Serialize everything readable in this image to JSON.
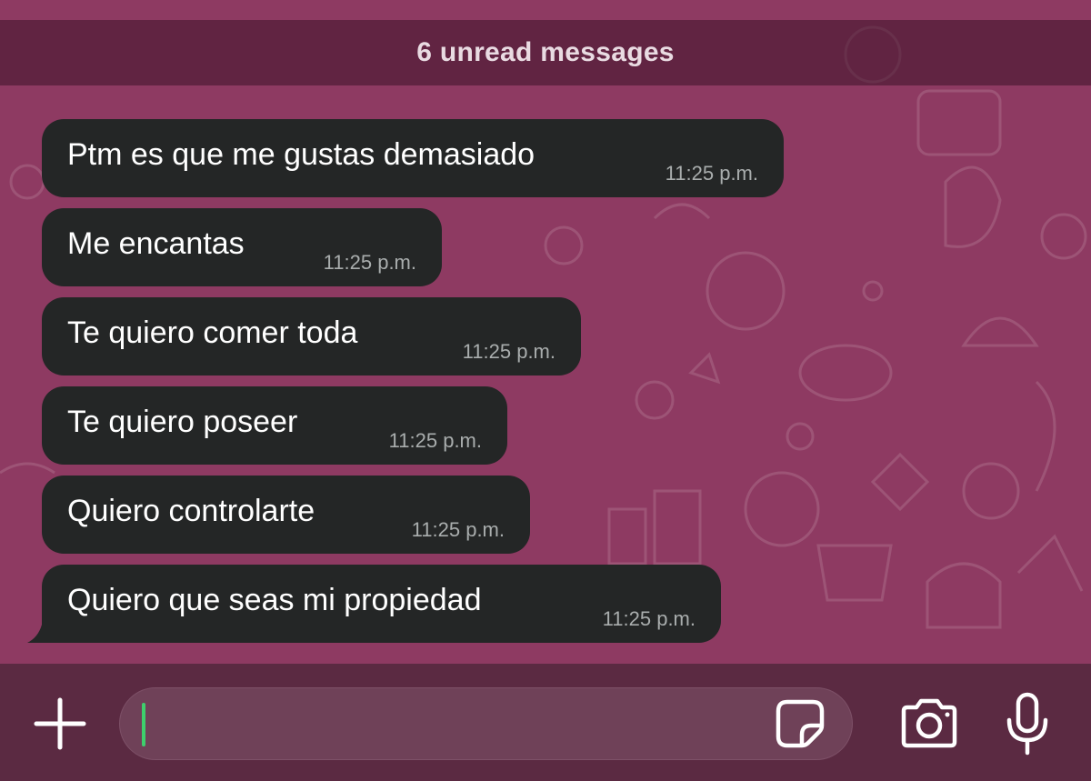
{
  "banner": {
    "unread_label": "6 unread messages"
  },
  "messages": [
    {
      "text": "Ptm es que me gustas demasiado",
      "time": "11:25 p.m."
    },
    {
      "text": "Me encantas",
      "time": "11:25 p.m."
    },
    {
      "text": "Te quiero comer toda",
      "time": "11:25 p.m."
    },
    {
      "text": "Te quiero poseer",
      "time": "11:25 p.m."
    },
    {
      "text": "Quiero controlarte",
      "time": "11:25 p.m."
    },
    {
      "text": "Quiero que seas mi propiedad",
      "time": "11:25 p.m."
    }
  ],
  "input_bar": {
    "message_value": "",
    "icons": [
      "plus-icon",
      "sticker-icon",
      "camera-icon",
      "microphone-icon"
    ]
  },
  "colors": {
    "wallpaper": "#8e3a62",
    "bubble": "#242626",
    "input_bar": "#5b2a42",
    "cursor": "#3ecf6c"
  }
}
